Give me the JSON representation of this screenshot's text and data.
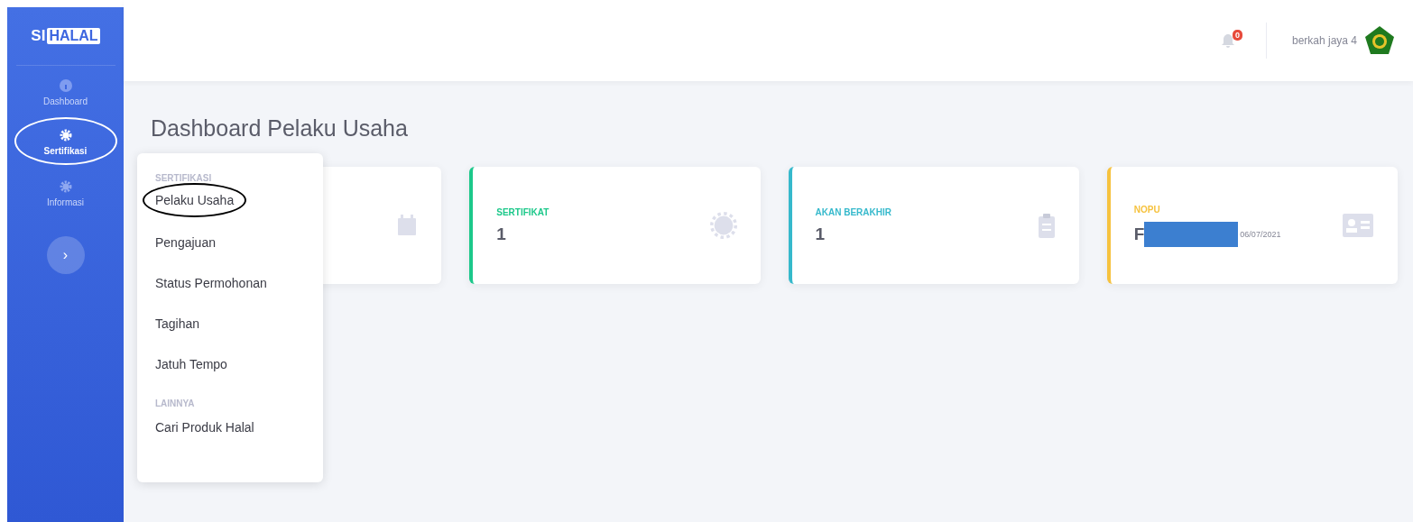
{
  "brand": {
    "part_1": "SI",
    "part_2": "HALAL"
  },
  "sidebar": {
    "items": [
      {
        "label": "Dashboard",
        "kind": "info",
        "selected": false,
        "circled": false
      },
      {
        "label": "Sertifikasi",
        "kind": "gear",
        "selected": true,
        "circled": true
      },
      {
        "label": "Informasi",
        "kind": "gear",
        "selected": false,
        "circled": false
      }
    ],
    "expand_button": "›"
  },
  "header": {
    "notification_count": "0",
    "user_name": "berkah jaya 4"
  },
  "page_title": "Dashboard Pelaku Usaha",
  "cards": [
    {
      "kind": "calendar"
    },
    {
      "kind": "gear",
      "label": "SERTIFIKAT",
      "value": "1",
      "color": "#1cc88a"
    },
    {
      "kind": "clipboard",
      "label": "AKAN BERAKHIR",
      "value": "1",
      "color": "#36b9cc"
    },
    {
      "kind": "idcard",
      "label": "NOPU",
      "value": "F",
      "redacted": true,
      "date": "06/07/2021",
      "color": "#f6c23e"
    }
  ],
  "menu": {
    "sections": [
      {
        "heading": "SERTIFIKASI",
        "items": [
          {
            "label": "Pelaku Usaha",
            "circled": true
          },
          {
            "label": "Pengajuan",
            "circled": false
          },
          {
            "label": "Status Permohonan",
            "circled": false
          },
          {
            "label": "Tagihan",
            "circled": false
          },
          {
            "label": "Jatuh Tempo",
            "circled": false
          }
        ]
      },
      {
        "heading": "LAINNYA",
        "items": [
          {
            "label": "Cari Produk Halal",
            "circled": false
          }
        ]
      }
    ]
  }
}
